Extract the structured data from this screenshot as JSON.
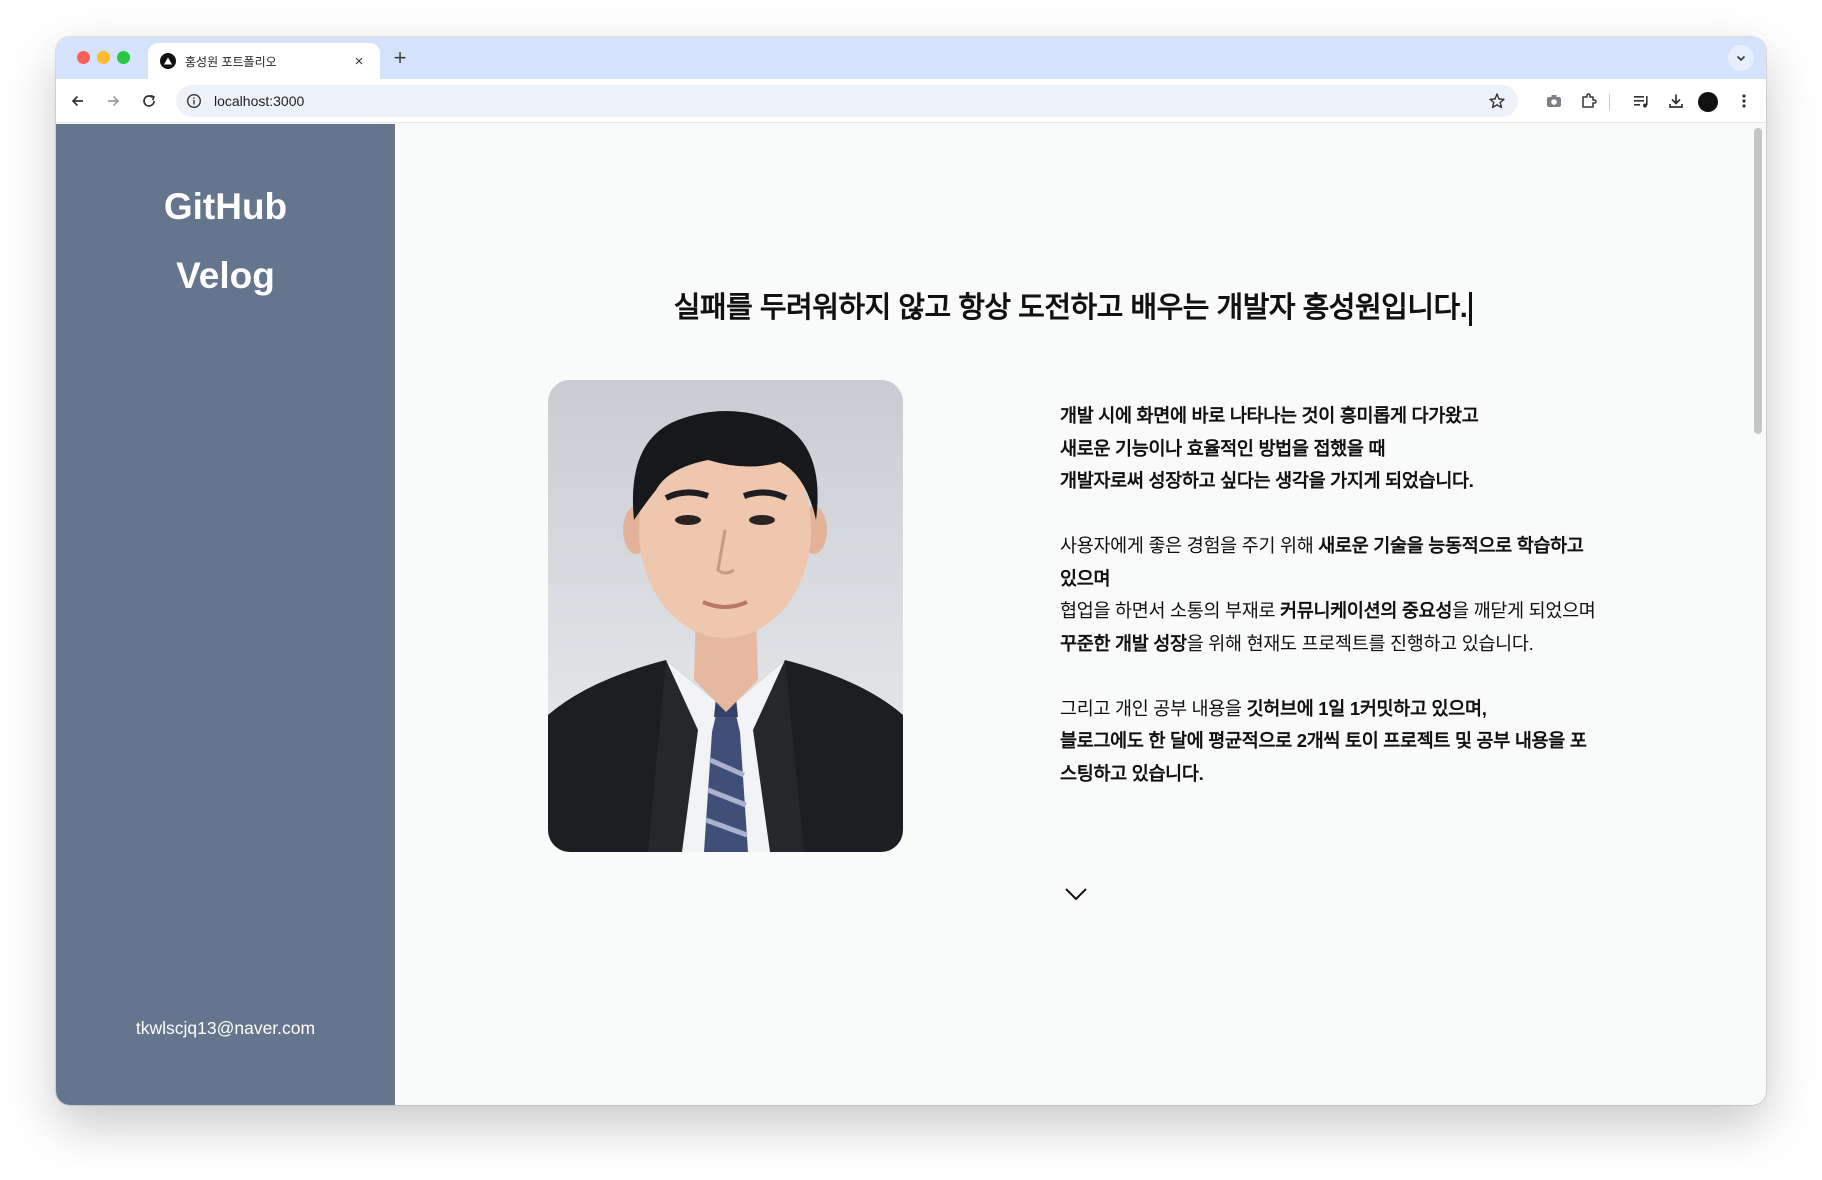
{
  "browser": {
    "tab_title": "홍성원 포트폴리오",
    "tab_close": "×",
    "new_tab": "+",
    "url": "localhost:3000",
    "icons": [
      "back-arrow-icon",
      "forward-arrow-icon",
      "reload-icon",
      "site-info-icon",
      "bookmark-star-icon",
      "camera-icon",
      "extensions-icon",
      "media-controls-icon",
      "download-icon",
      "profile-avatar",
      "more-menu-icon",
      "tab-search-icon"
    ]
  },
  "sidebar": {
    "background": "#65758d",
    "github_label": "GitHub",
    "velog_label": "Velog",
    "email": "tkwlscjq13@naver.com"
  },
  "main": {
    "headline": "실패를 두려워하지 않고 항상 도전하고 배우는 개발자 홍성원입니다.",
    "photo_alt": "profile-photo",
    "intro": {
      "p1": {
        "l1": "개발 시에 화면에 바로 나타나는 것이 흥미롭게 다가왔고",
        "l2": "새로운 기능이나 효율적인 방법을 접했을 때",
        "l3": "개발자로써 성장하고 싶다는 생각을 가지게 되었습니다."
      },
      "p2": {
        "a1": "사용자에게 좋은 경험을 주기 위해 ",
        "b1": "새로운 기술을 능동적으로 학습하고 있으며",
        "a2": "협업을 하면서 소통의 부재로 ",
        "b2": "커뮤니케이션의 중요성",
        "a3": "을 깨닫게 되었으며",
        "b3": "꾸준한 개발 성장",
        "a4": "을 위해 현재도 프로젝트를 진행하고 있습니다."
      },
      "p3": {
        "a1": "그리고 개인 공부 내용을 ",
        "b1": "깃허브에 1일 1커밋하고 있으며,",
        "b2": "블로그에도 한 달에 평균적으로 2개씩 토이 프로젝트 및 공부 내용을 포스팅하고 있습니다."
      }
    },
    "scroll_icon": "chevron-down-icon"
  }
}
